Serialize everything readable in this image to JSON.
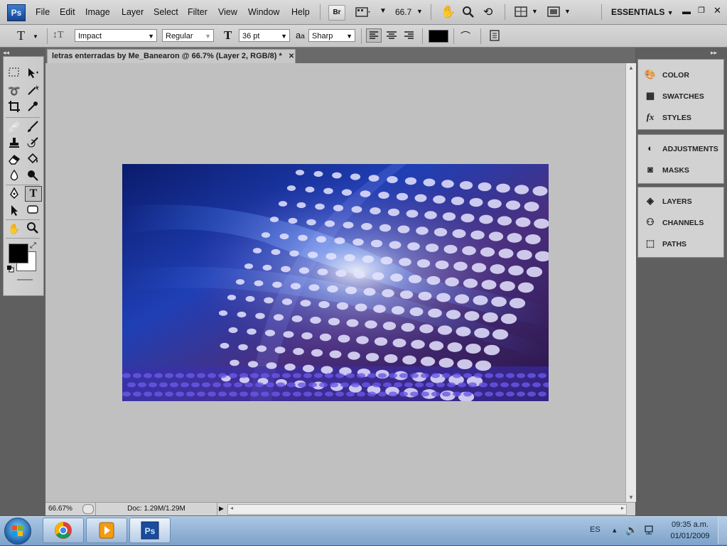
{
  "menubar": {
    "app_logo": "Ps",
    "menus": [
      "File",
      "Edit",
      "Image",
      "Layer",
      "Select",
      "Filter",
      "View",
      "Window",
      "Help"
    ],
    "bridge_label": "Br",
    "zoom_value": "66.7",
    "workspace": "ESSENTIALS"
  },
  "options": {
    "font_family": "Impact",
    "font_style": "Regular",
    "font_size": "36 pt",
    "aa_label": "a",
    "aa_mode": "Sharp",
    "text_color": "#000000"
  },
  "document": {
    "tab_title": "letras enterradas by Me_Banearon @ 66.7% (Layer 2, RGB/8) *",
    "zoom_status": "66.67%",
    "doc_info": "Doc: 1.29M/1.29M"
  },
  "panels": {
    "group1": [
      "COLOR",
      "SWATCHES",
      "STYLES"
    ],
    "group2": [
      "ADJUSTMENTS",
      "MASKS"
    ],
    "group3": [
      "LAYERS",
      "CHANNELS",
      "PATHS"
    ]
  },
  "taskbar": {
    "language": "ES",
    "time": "09:35 a.m.",
    "date": "01/01/2009"
  },
  "colors": {
    "foreground": "#000000",
    "background": "#ffffff",
    "annotation_arrow": "#e02020"
  }
}
